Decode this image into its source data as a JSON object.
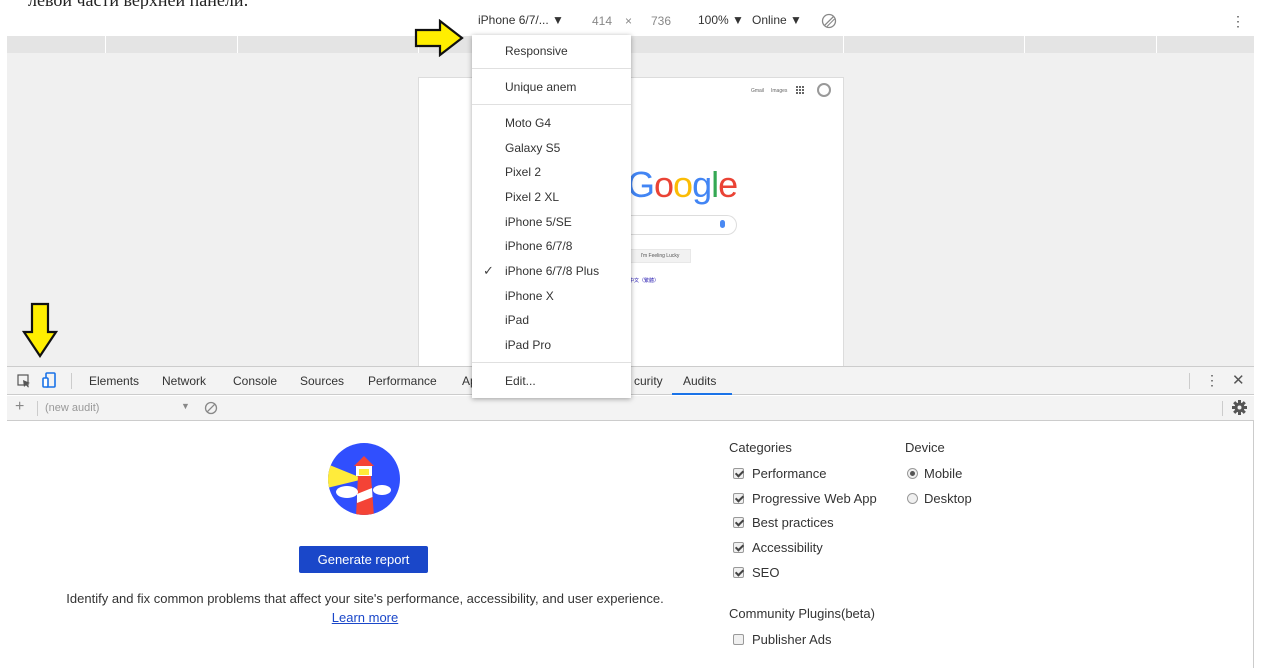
{
  "top_caption": "левой части верхней панели:",
  "device_toolbar": {
    "device_name": "iPhone 6/7/... ▼",
    "width": "414",
    "times": "×",
    "height": "736",
    "zoom": "100% ▼",
    "throttle": "Online ▼"
  },
  "device_menu": {
    "items": [
      "Responsive",
      "Unique anem",
      "Moto G4",
      "Galaxy S5",
      "Pixel 2",
      "Pixel 2 XL",
      "iPhone 5/SE",
      "iPhone 6/7/8",
      "iPhone 6/7/8 Plus",
      "iPhone X",
      "iPad",
      "iPad Pro",
      "Edit..."
    ],
    "checked_item": "iPhone 6/7/8 Plus",
    "check_mark": "✓"
  },
  "page_preview": {
    "gmail": "Gmail",
    "images": "Images",
    "logo": "Google",
    "lucky_button": "I'm Feeling Lucky",
    "languages": "中文（繁體）"
  },
  "devtools_tabs": [
    "Elements",
    "Network",
    "Console",
    "Sources",
    "Performance",
    "Ap",
    "curity",
    "Audits"
  ],
  "active_tab": "Audits",
  "audit_toolbar": {
    "add": "+",
    "select_value": "(new audit)",
    "caret": "▼"
  },
  "audits": {
    "generate_button": "Generate report",
    "description": "Identify and fix common problems that affect your site's performance, accessibility, and user experience.",
    "learn_more": "Learn more",
    "categories_heading": "Categories",
    "categories": [
      {
        "label": "Performance",
        "checked": true
      },
      {
        "label": "Progressive Web App",
        "checked": true
      },
      {
        "label": "Best practices",
        "checked": true
      },
      {
        "label": "Accessibility",
        "checked": true
      },
      {
        "label": "SEO",
        "checked": true
      }
    ],
    "device_heading": "Device",
    "devices": [
      {
        "label": "Mobile",
        "checked": true
      },
      {
        "label": "Desktop",
        "checked": false
      }
    ],
    "plugins_heading": "Community Plugins(beta)",
    "plugins": [
      {
        "label": "Publisher Ads",
        "checked": false
      }
    ]
  },
  "colors": {
    "accent": "#1a73e8",
    "button": "#1a47c9",
    "arrow_fill": "#ffee00",
    "arrow_stroke": "#111111"
  },
  "icons": {
    "rotate": "rotate-disabled-icon",
    "kebab": "kebab-menu-icon",
    "inspect": "inspect-element-icon",
    "device": "device-mode-icon",
    "close": "close-icon",
    "clear": "clear-icon",
    "gear": "gear-icon",
    "lighthouse": "lighthouse-logo",
    "pointer_right": "yellow-arrow-right-icon",
    "pointer_down": "yellow-arrow-down-icon"
  }
}
